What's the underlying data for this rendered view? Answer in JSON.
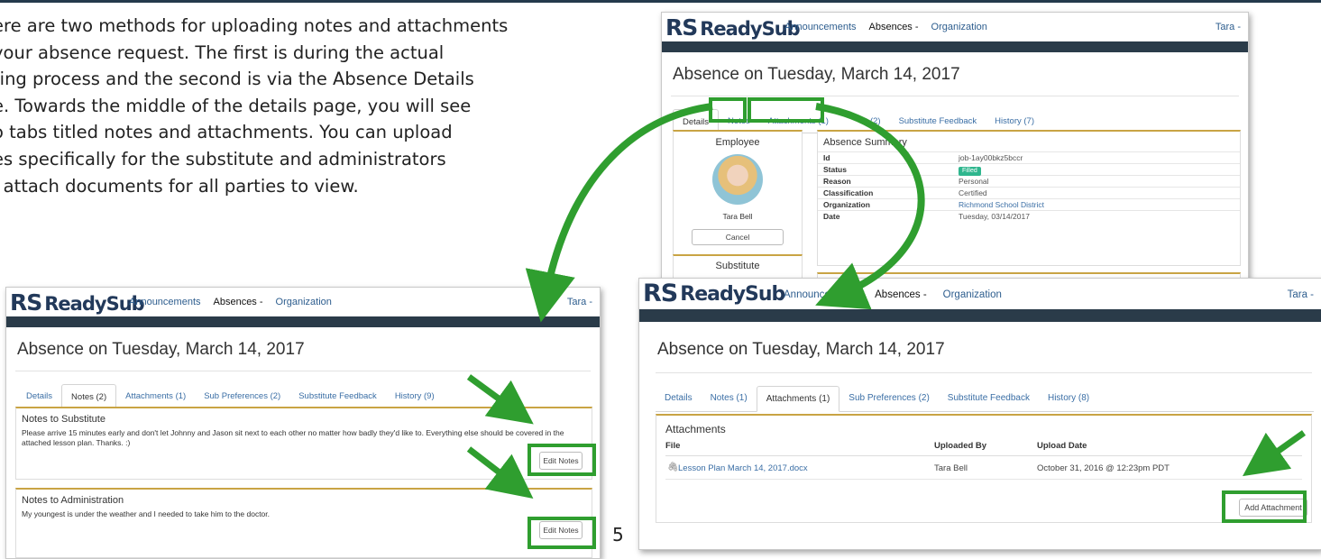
{
  "intro_lines": [
    "ere are two methods for uploading notes and attachments",
    "your absence request. The first is during the actual",
    "ting process and the second is via the Absence Details",
    "e. Towards the middle of the details page, you will see",
    "o tabs titled notes and attachments.  You can upload",
    "es specifically for the substitute and administrators",
    "l attach documents for all parties to view."
  ],
  "page_number": "5",
  "app": {
    "logo_mark": "RS",
    "logo_name": "ReadySub",
    "nav_announcements": "Announcements",
    "nav_absences": "Absences -",
    "nav_organization": "Organization",
    "user_menu": "Tara -"
  },
  "page_title": "Absence on Tuesday, March 14, 2017",
  "top_shot": {
    "tabs": [
      {
        "label": "Details"
      },
      {
        "label": "Notes"
      },
      {
        "label": "Attachments (1)"
      },
      {
        "label": "(2)"
      },
      {
        "label": "Substitute Feedback"
      },
      {
        "label": "History (7)"
      }
    ],
    "employee_title": "Employee",
    "employee_name": "Tara Bell",
    "cancel_label": "Cancel",
    "substitute_title": "Substitute",
    "summary_title": "Absence Summary",
    "summary_rows": [
      {
        "key": "Id",
        "value": "job-1ay00bkz5bccr"
      },
      {
        "key": "Status",
        "value": "Filled"
      },
      {
        "key": "Reason",
        "value": "Personal"
      },
      {
        "key": "Classification",
        "value": "Certified"
      },
      {
        "key": "Organization",
        "value": "Richmond School District"
      },
      {
        "key": "Date",
        "value": "Tuesday, 03/14/2017"
      }
    ]
  },
  "notes_shot": {
    "tabs": [
      {
        "label": "Details"
      },
      {
        "label": "Notes (2)"
      },
      {
        "label": "Attachments (1)"
      },
      {
        "label": "Sub Preferences (2)"
      },
      {
        "label": "Substitute Feedback"
      },
      {
        "label": "History (9)"
      }
    ],
    "sub_title": "Notes to Substitute",
    "sub_text": "Please arrive 15 minutes early and don't let Johnny and Jason sit next to each other no matter how badly they'd like to. Everything else should be covered in the attached lesson plan. Thanks. :)",
    "admin_title": "Notes to Administration",
    "admin_text": "My youngest is under the weather and I needed to take him to the doctor.",
    "edit_label": "Edit Notes"
  },
  "attach_shot": {
    "tabs": [
      {
        "label": "Details"
      },
      {
        "label": "Notes (1)"
      },
      {
        "label": "Attachments (1)"
      },
      {
        "label": "Sub Preferences (2)"
      },
      {
        "label": "Substitute Feedback"
      },
      {
        "label": "History (8)"
      }
    ],
    "section_title": "Attachments",
    "col_file": "File",
    "col_by": "Uploaded By",
    "col_date": "Upload Date",
    "file_name": "Lesson Plan March 14, 2017.docx",
    "uploaded_by": "Tara Bell",
    "upload_date": "October 31, 2016 @ 12:23pm PDT",
    "add_label": "Add Attachment"
  },
  "colors": {
    "callout_green": "#2f9e2f",
    "navy": "#22395a",
    "card_accent": "#c9a444",
    "link_blue": "#3a6ea5"
  }
}
